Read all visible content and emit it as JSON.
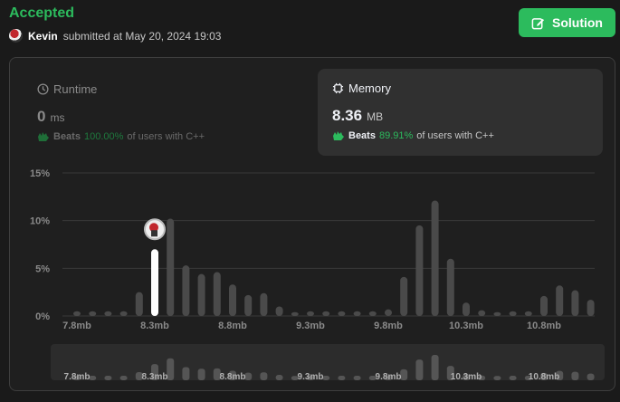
{
  "header": {
    "status": "Accepted",
    "user": "Kevin",
    "submitted_text": "submitted at May 20, 2024 19:03",
    "solution_label": "Solution"
  },
  "runtime": {
    "label": "Runtime",
    "value": "0",
    "unit": "ms",
    "beats_label": "Beats",
    "beats_pct": "100.00%",
    "beats_suffix": "of users with C++"
  },
  "memory": {
    "label": "Memory",
    "value": "8.36",
    "unit": "MB",
    "beats_label": "Beats",
    "beats_pct": "89.91%",
    "beats_suffix": "of users with C++"
  },
  "colors": {
    "accent": "#2cbb5d",
    "bar": "#4a4a4a",
    "selected_bar": "#ffffff"
  },
  "chart_data": {
    "type": "bar",
    "ylim": [
      0,
      15
    ],
    "yticks": [
      "0%",
      "5%",
      "10%",
      "15%"
    ],
    "ytick_values": [
      0,
      5,
      10,
      15
    ],
    "grid": true,
    "xtick_labels": [
      "7.8mb",
      "8.3mb",
      "8.8mb",
      "9.3mb",
      "9.8mb",
      "10.3mb",
      "10.8mb"
    ],
    "xtick_indices": [
      0,
      5,
      10,
      15,
      20,
      25,
      30
    ],
    "values": [
      0.5,
      0.5,
      0.5,
      0.5,
      2.5,
      7.0,
      10.2,
      5.3,
      4.4,
      4.6,
      3.3,
      2.2,
      2.4,
      1.0,
      0.4,
      0.5,
      0.5,
      0.5,
      0.5,
      0.5,
      0.7,
      4.1,
      9.5,
      12.1,
      6.0,
      1.4,
      0.6,
      0.4,
      0.5,
      0.5,
      2.1,
      3.2,
      2.7,
      1.7
    ],
    "highlight_index": 5
  }
}
